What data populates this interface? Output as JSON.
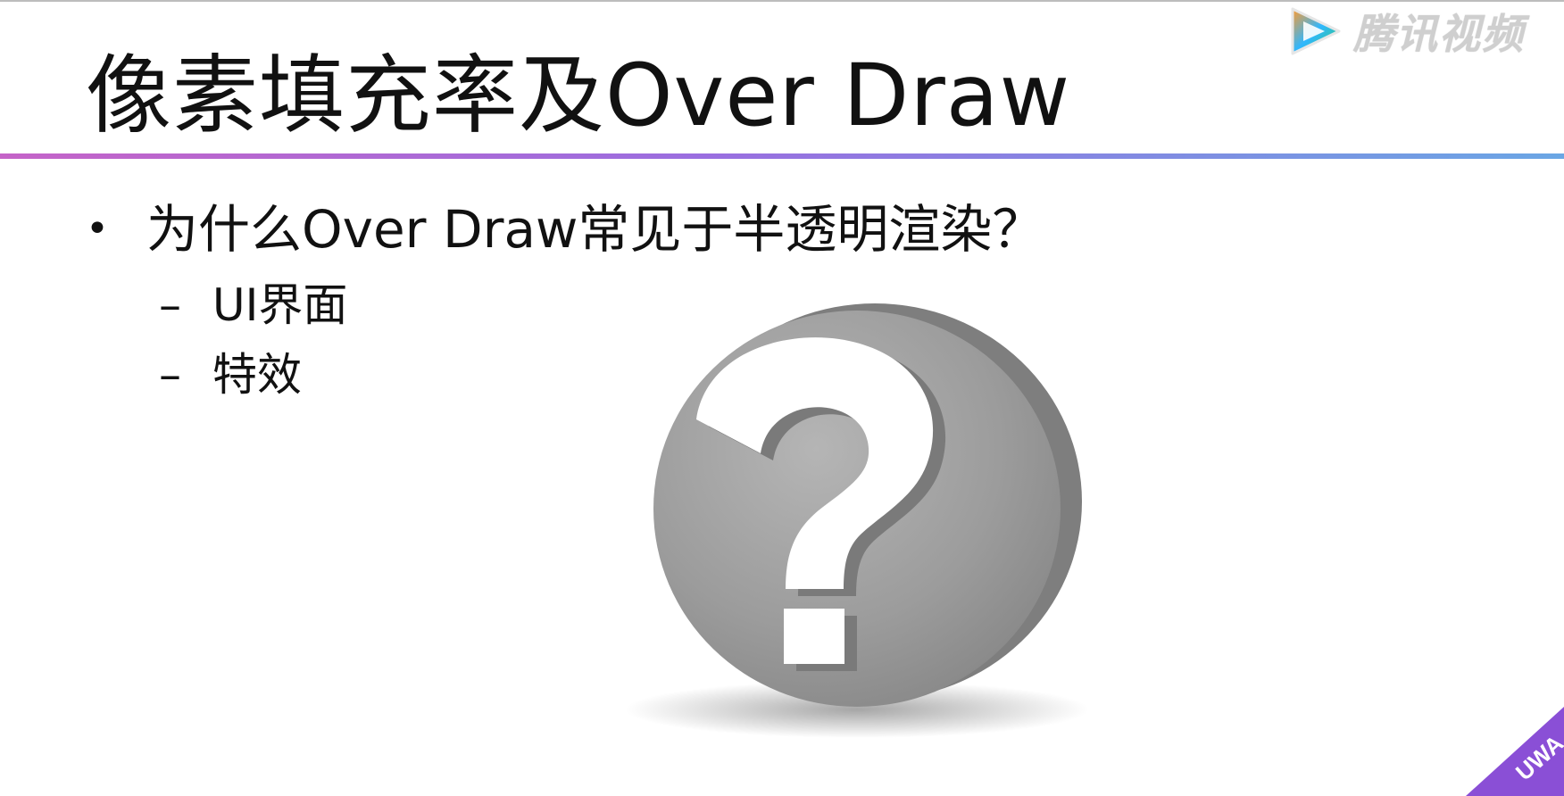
{
  "slide": {
    "title": "像素填充率及Over Draw",
    "bullet": {
      "marker": "•",
      "text": "为什么Over Draw常见于半透明渲染？"
    },
    "sub_items": [
      {
        "marker": "–",
        "text": "UI界面"
      },
      {
        "marker": "–",
        "text": "特效"
      }
    ]
  },
  "watermark": {
    "brand": "腾讯视频",
    "play_icon": "play-triangle-icon",
    "corner_badge_text": "UWA"
  },
  "illustration": {
    "icon": "question-mark-icon",
    "glyph": "?"
  },
  "colors": {
    "underline_start": "#c563c8",
    "underline_mid": "#9a6ee0",
    "underline_end": "#6aa6e4",
    "badge": "#8a4fd6",
    "disc": "#9a9a9a"
  }
}
